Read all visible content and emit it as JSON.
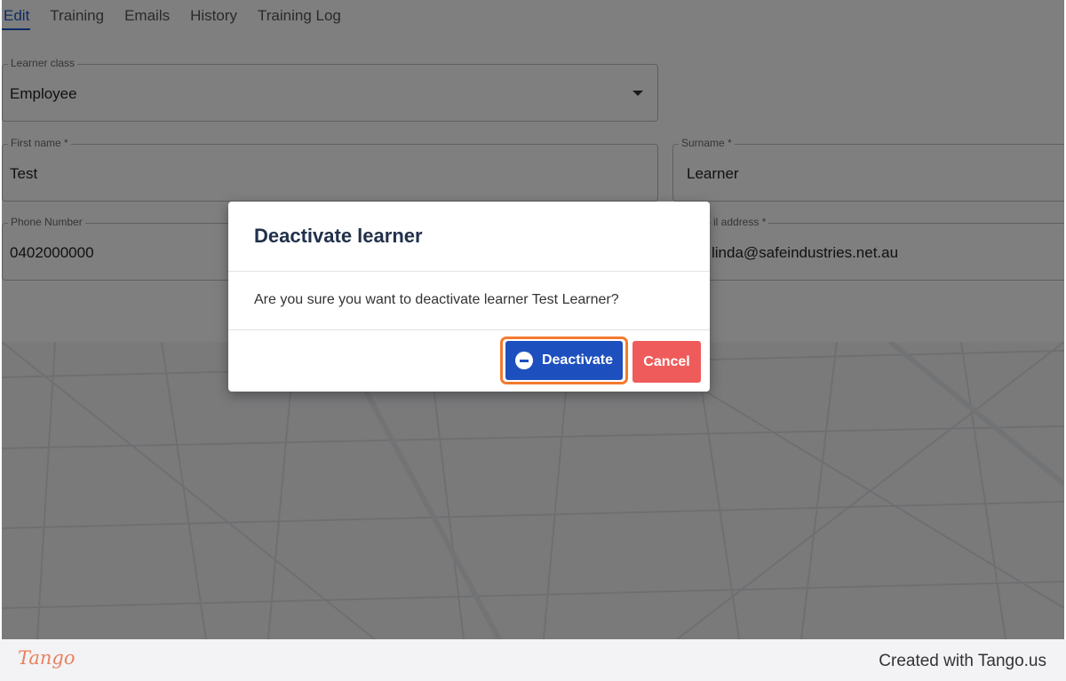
{
  "tabs": [
    {
      "label": "Edit",
      "active": true
    },
    {
      "label": "Training",
      "active": false
    },
    {
      "label": "Emails",
      "active": false
    },
    {
      "label": "History",
      "active": false
    },
    {
      "label": "Training Log",
      "active": false
    }
  ],
  "form": {
    "learner_class": {
      "label": "Learner class",
      "value": "Employee"
    },
    "first_name": {
      "label": "First name *",
      "value": "Test"
    },
    "surname": {
      "label": "Surname *",
      "value": "Learner"
    },
    "phone": {
      "label": "Phone Number",
      "value": "0402000000"
    },
    "email": {
      "label": "il address *",
      "value": "linda@safeindustries.net.au"
    }
  },
  "dialog": {
    "title": "Deactivate learner",
    "message": "Are you sure you want to deactivate learner Test Learner?",
    "confirm_label": "Deactivate",
    "cancel_label": "Cancel"
  },
  "footer": {
    "logo": "Tango",
    "credit": "Created with Tango.us"
  },
  "colors": {
    "accent": "#1a56c4",
    "confirm_button": "#1e4fbf",
    "cancel_button": "#ef5b5b",
    "focus_ring": "#f47a2f",
    "logo": "#e8825d"
  },
  "icons": {
    "confirm_button_icon": "minus-circle-icon",
    "select_caret": "caret-down-icon"
  }
}
